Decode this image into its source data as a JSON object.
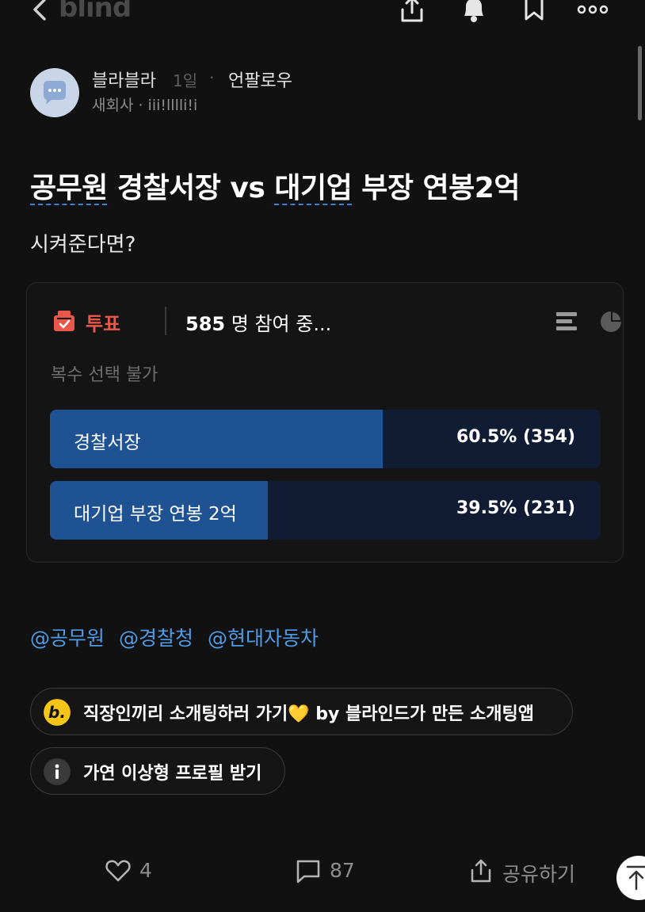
{
  "header": {
    "logo": "blind",
    "icons": [
      "back-icon",
      "share-icon",
      "bell-icon",
      "bookmark-icon",
      "more-icon"
    ]
  },
  "author": {
    "name": "블라블라",
    "time": "1일",
    "dot": "·",
    "follow": "언팔로우",
    "company": "새회사 · iii!lllli!i"
  },
  "post": {
    "title_part1": "공무원",
    "title_part2": " 경찰서장 vs ",
    "title_part3": "대기업",
    "title_part4": " 부장 연봉2억",
    "body": "시켜준다면?"
  },
  "poll": {
    "label": "투표",
    "count": "585",
    "participants_suffix": " 명 참여 중...",
    "note": "복수 선택 불가",
    "options": [
      {
        "label": "경찰서장",
        "value": "60.5% (354)",
        "fraction": 0.605
      },
      {
        "label": "대기업 부장 연봉 2억",
        "value": "39.5% (231)",
        "fraction": 0.395
      }
    ]
  },
  "tags": [
    "@공무원",
    "@경찰청",
    "@현대자동차"
  ],
  "chips": {
    "dating": "직장인끼리 소개팅하러 가기💛 by 블라인드가 만든 소개팅앱",
    "profile": "가연 이상형 프로필 받기"
  },
  "actions": {
    "likes": "4",
    "comments": "87",
    "share": "공유하기"
  },
  "colors": {
    "background": "#111111",
    "poll_fill": "#1f5292",
    "poll_track": "#0f1c33",
    "vote_accent": "#e9574b",
    "tag_blue": "#4f9be6"
  }
}
